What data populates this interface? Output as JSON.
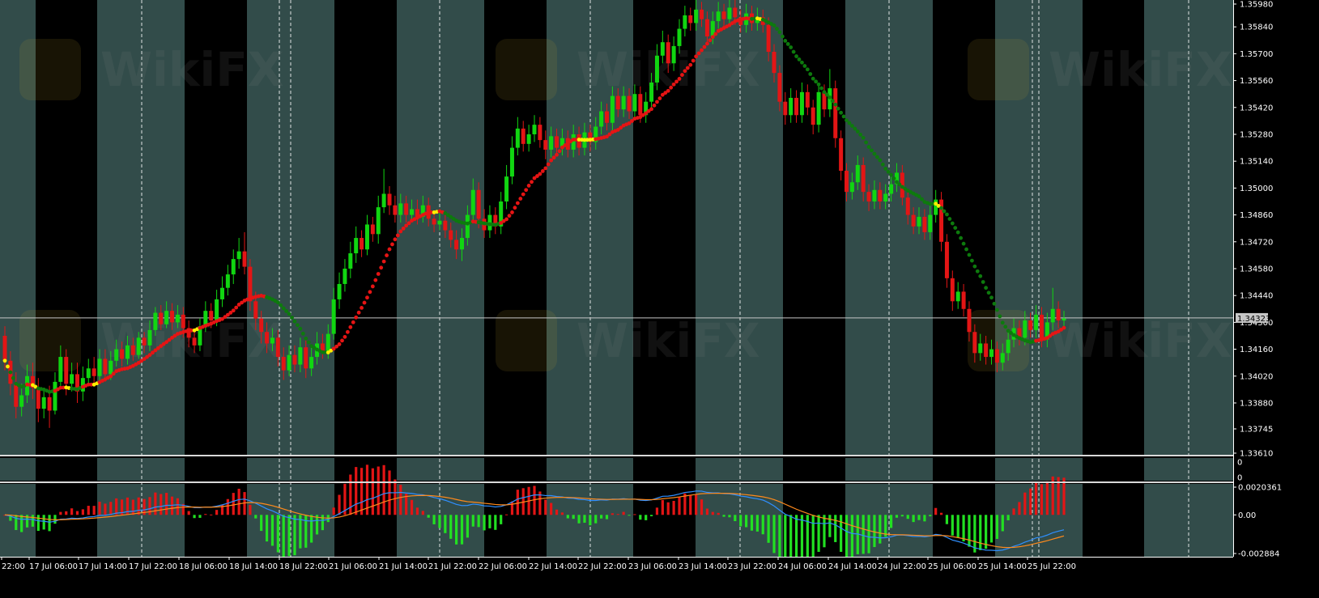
{
  "chart_data": {
    "type": "candlestick",
    "symbol": "",
    "title": "",
    "current_price_label": "1.34323",
    "current_price": 1.34323,
    "colors": {
      "bull": "#11d611",
      "bear": "#e31515",
      "ma_flat": "#ffee00",
      "ma_up": "#e61414",
      "ma_down": "#0d7a0d",
      "session_band": "#324c4a",
      "night_band": "#000000",
      "macd_hist_pos": "#e31515",
      "macd_hist_neg": "#22e022",
      "macd_line": "#2f8fff",
      "signal_line": "#ff8a1c",
      "price_line": "#c6c6c6"
    },
    "price_axis": {
      "ylim": [
        1.3361,
        1.3598
      ],
      "ticks": [
        "1.35980",
        "1.35840",
        "1.35700",
        "1.35560",
        "1.35420",
        "1.35280",
        "1.35140",
        "1.35000",
        "1.34860",
        "1.34720",
        "1.34580",
        "1.34440",
        "1.34300",
        "1.34160",
        "1.34020",
        "1.33880",
        "1.33745",
        "1.33610"
      ]
    },
    "x_axis": {
      "labels": [
        "22:00",
        "17 Jul 06:00",
        "17 Jul 14:00",
        "17 Jul 22:00",
        "18 Jul 06:00",
        "18 Jul 14:00",
        "18 Jul 22:00",
        "21 Jul 06:00",
        "21 Jul 14:00",
        "21 Jul 22:00",
        "22 Jul 06:00",
        "22 Jul 14:00",
        "22 Jul 22:00",
        "23 Jul 06:00",
        "23 Jul 14:00",
        "23 Jul 22:00",
        "24 Jul 06:00",
        "24 Jul 14:00",
        "24 Jul 22:00",
        "25 Jul 06:00",
        "25 Jul 14:00",
        "25 Jul 22:00"
      ]
    },
    "sessions": [
      "night",
      "day",
      "night",
      "day",
      "night",
      "day",
      "night",
      "day",
      "night",
      "day",
      "night",
      "day",
      "night",
      "day",
      "night",
      "day",
      "night",
      "day",
      "night"
    ],
    "candles": [
      [
        1.3423,
        1.341,
        1.3428,
        1.3405
      ],
      [
        1.341,
        1.3398,
        1.3415,
        1.3392
      ],
      [
        1.3398,
        1.3386,
        1.3404,
        1.338
      ],
      [
        1.3386,
        1.3392,
        1.3398,
        1.3381
      ],
      [
        1.3392,
        1.3402,
        1.3408,
        1.3388
      ],
      [
        1.3402,
        1.3396,
        1.3409,
        1.339
      ],
      [
        1.3396,
        1.3385,
        1.3401,
        1.3378
      ],
      [
        1.3385,
        1.3391,
        1.3396,
        1.338
      ],
      [
        1.3391,
        1.3384,
        1.3397,
        1.3375
      ],
      [
        1.3384,
        1.3399,
        1.3404,
        1.3382
      ],
      [
        1.3399,
        1.3412,
        1.3418,
        1.3395
      ],
      [
        1.3412,
        1.3398,
        1.3416,
        1.3392
      ],
      [
        1.3398,
        1.3403,
        1.3409,
        1.3394
      ],
      [
        1.3403,
        1.3394,
        1.3409,
        1.3388
      ],
      [
        1.3394,
        1.3401,
        1.3407,
        1.3389
      ],
      [
        1.3401,
        1.3406,
        1.3411,
        1.3397
      ],
      [
        1.3406,
        1.3402,
        1.3412,
        1.3398
      ],
      [
        1.3402,
        1.3411,
        1.3416,
        1.3399
      ],
      [
        1.3411,
        1.3403,
        1.3416,
        1.3399
      ],
      [
        1.3403,
        1.341,
        1.3415,
        1.34
      ],
      [
        1.341,
        1.3416,
        1.3421,
        1.3407
      ],
      [
        1.3416,
        1.3411,
        1.342,
        1.3407
      ],
      [
        1.3411,
        1.3418,
        1.3423,
        1.3408
      ],
      [
        1.3418,
        1.3413,
        1.3422,
        1.341
      ],
      [
        1.3413,
        1.3422,
        1.3425,
        1.3411
      ],
      [
        1.3422,
        1.3418,
        1.3425,
        1.3414
      ],
      [
        1.3418,
        1.3426,
        1.3431,
        1.3415
      ],
      [
        1.3426,
        1.3435,
        1.3438,
        1.3423
      ],
      [
        1.3435,
        1.3429,
        1.3439,
        1.3426
      ],
      [
        1.3429,
        1.3436,
        1.3441,
        1.3427
      ],
      [
        1.3436,
        1.343,
        1.344,
        1.3426
      ],
      [
        1.343,
        1.3434,
        1.3439,
        1.3427
      ],
      [
        1.3434,
        1.3427,
        1.3438,
        1.3422
      ],
      [
        1.3427,
        1.3422,
        1.3431,
        1.3417
      ],
      [
        1.3422,
        1.3418,
        1.3426,
        1.3414
      ],
      [
        1.3418,
        1.3428,
        1.3432,
        1.3415
      ],
      [
        1.3428,
        1.3436,
        1.3441,
        1.3425
      ],
      [
        1.3436,
        1.3431,
        1.344,
        1.3427
      ],
      [
        1.3431,
        1.3442,
        1.3447,
        1.3428
      ],
      [
        1.3442,
        1.3448,
        1.3454,
        1.3438
      ],
      [
        1.3448,
        1.3455,
        1.346,
        1.3444
      ],
      [
        1.3455,
        1.3463,
        1.3468,
        1.345
      ],
      [
        1.3463,
        1.3467,
        1.3474,
        1.3458
      ],
      [
        1.3467,
        1.3459,
        1.3477,
        1.3455
      ],
      [
        1.3459,
        1.3441,
        1.3463,
        1.3436
      ],
      [
        1.3441,
        1.3432,
        1.3446,
        1.3426
      ],
      [
        1.3432,
        1.3425,
        1.3436,
        1.3419
      ],
      [
        1.3425,
        1.3419,
        1.343,
        1.3414
      ],
      [
        1.3419,
        1.3422,
        1.3427,
        1.3415
      ],
      [
        1.3422,
        1.3412,
        1.3426,
        1.3407
      ],
      [
        1.3412,
        1.3405,
        1.3417,
        1.34
      ],
      [
        1.3405,
        1.3413,
        1.3418,
        1.3402
      ],
      [
        1.3413,
        1.3408,
        1.3418,
        1.3404
      ],
      [
        1.3408,
        1.3417,
        1.3422,
        1.3404
      ],
      [
        1.3417,
        1.3406,
        1.3421,
        1.3401
      ],
      [
        1.3406,
        1.3412,
        1.3418,
        1.3402
      ],
      [
        1.3412,
        1.3419,
        1.3425,
        1.3408
      ],
      [
        1.3419,
        1.3415,
        1.3424,
        1.3411
      ],
      [
        1.3415,
        1.3424,
        1.3429,
        1.3411
      ],
      [
        1.3424,
        1.3442,
        1.3448,
        1.3421
      ],
      [
        1.3442,
        1.345,
        1.3456,
        1.3437
      ],
      [
        1.345,
        1.3458,
        1.3463,
        1.3446
      ],
      [
        1.3458,
        1.3466,
        1.3472,
        1.3453
      ],
      [
        1.3466,
        1.3474,
        1.348,
        1.3461
      ],
      [
        1.3474,
        1.3468,
        1.3478,
        1.3464
      ],
      [
        1.3468,
        1.3481,
        1.3486,
        1.3465
      ],
      [
        1.3481,
        1.3476,
        1.3485,
        1.3472
      ],
      [
        1.3476,
        1.349,
        1.3496,
        1.3471
      ],
      [
        1.349,
        1.3497,
        1.351,
        1.3487
      ],
      [
        1.3497,
        1.3491,
        1.3501,
        1.3486
      ],
      [
        1.3491,
        1.3486,
        1.3496,
        1.3482
      ],
      [
        1.3486,
        1.3492,
        1.3497,
        1.3482
      ],
      [
        1.3492,
        1.3486,
        1.3496,
        1.3482
      ],
      [
        1.3486,
        1.3489,
        1.3494,
        1.3483
      ],
      [
        1.3489,
        1.3485,
        1.3494,
        1.3481
      ],
      [
        1.3485,
        1.3491,
        1.3496,
        1.3482
      ],
      [
        1.3491,
        1.3484,
        1.3495,
        1.348
      ],
      [
        1.3484,
        1.3481,
        1.3488,
        1.3477
      ],
      [
        1.3481,
        1.3483,
        1.3488,
        1.3478
      ],
      [
        1.3483,
        1.3478,
        1.3487,
        1.3474
      ],
      [
        1.3478,
        1.3473,
        1.3482,
        1.3469
      ],
      [
        1.3473,
        1.3468,
        1.3478,
        1.3463
      ],
      [
        1.3468,
        1.3474,
        1.3479,
        1.3462
      ],
      [
        1.3474,
        1.3486,
        1.3491,
        1.347
      ],
      [
        1.3486,
        1.3499,
        1.3505,
        1.3482
      ],
      [
        1.3499,
        1.3484,
        1.3503,
        1.3479
      ],
      [
        1.3484,
        1.3478,
        1.3489,
        1.3474
      ],
      [
        1.3478,
        1.3486,
        1.3491,
        1.3474
      ],
      [
        1.3486,
        1.348,
        1.349,
        1.3476
      ],
      [
        1.348,
        1.3493,
        1.3498,
        1.3476
      ],
      [
        1.3493,
        1.3506,
        1.3512,
        1.3489
      ],
      [
        1.3506,
        1.3521,
        1.3527,
        1.3502
      ],
      [
        1.3521,
        1.3531,
        1.3537,
        1.3517
      ],
      [
        1.3531,
        1.3523,
        1.3535,
        1.3519
      ],
      [
        1.3523,
        1.3528,
        1.3533,
        1.3519
      ],
      [
        1.3528,
        1.3533,
        1.3538,
        1.3524
      ],
      [
        1.3533,
        1.3525,
        1.3537,
        1.3521
      ],
      [
        1.3525,
        1.352,
        1.353,
        1.3515
      ],
      [
        1.352,
        1.3527,
        1.3532,
        1.3516
      ],
      [
        1.3527,
        1.3521,
        1.3531,
        1.3517
      ],
      [
        1.3521,
        1.3526,
        1.3531,
        1.3517
      ],
      [
        1.3526,
        1.352,
        1.353,
        1.3516
      ],
      [
        1.352,
        1.3528,
        1.3533,
        1.3516
      ],
      [
        1.3528,
        1.3521,
        1.3532,
        1.3517
      ],
      [
        1.3521,
        1.3529,
        1.3534,
        1.3517
      ],
      [
        1.3529,
        1.3524,
        1.3533,
        1.3519
      ],
      [
        1.3524,
        1.3532,
        1.3537,
        1.352
      ],
      [
        1.3532,
        1.354,
        1.3545,
        1.3528
      ],
      [
        1.354,
        1.3534,
        1.3544,
        1.353
      ],
      [
        1.3534,
        1.3548,
        1.3553,
        1.353
      ],
      [
        1.3548,
        1.3541,
        1.3552,
        1.3537
      ],
      [
        1.3541,
        1.3548,
        1.3553,
        1.3537
      ],
      [
        1.3548,
        1.354,
        1.3552,
        1.3536
      ],
      [
        1.354,
        1.3549,
        1.3554,
        1.3536
      ],
      [
        1.3549,
        1.3538,
        1.3553,
        1.3534
      ],
      [
        1.3538,
        1.3545,
        1.355,
        1.3534
      ],
      [
        1.3545,
        1.3555,
        1.356,
        1.3541
      ],
      [
        1.3555,
        1.3569,
        1.3575,
        1.3551
      ],
      [
        1.3569,
        1.3576,
        1.3582,
        1.3565
      ],
      [
        1.3576,
        1.3565,
        1.358,
        1.356
      ],
      [
        1.3565,
        1.3574,
        1.3579,
        1.3561
      ],
      [
        1.3574,
        1.3583,
        1.3588,
        1.357
      ],
      [
        1.3583,
        1.359,
        1.3595,
        1.3579
      ],
      [
        1.359,
        1.3586,
        1.3594,
        1.3582
      ],
      [
        1.3586,
        1.3593,
        1.3598,
        1.3582
      ],
      [
        1.3593,
        1.3588,
        1.3597,
        1.3584
      ],
      [
        1.3588,
        1.3579,
        1.3592,
        1.3575
      ],
      [
        1.3579,
        1.3587,
        1.3592,
        1.3575
      ],
      [
        1.3587,
        1.3592,
        1.3597,
        1.3583
      ],
      [
        1.3592,
        1.3588,
        1.3596,
        1.3584
      ],
      [
        1.3588,
        1.3594,
        1.3599,
        1.3584
      ],
      [
        1.3594,
        1.3589,
        1.3598,
        1.3585
      ],
      [
        1.3589,
        1.3585,
        1.3593,
        1.3581
      ],
      [
        1.3585,
        1.3591,
        1.3596,
        1.3581
      ],
      [
        1.3591,
        1.3586,
        1.3595,
        1.3582
      ],
      [
        1.3586,
        1.3589,
        1.3594,
        1.3582
      ],
      [
        1.3589,
        1.3585,
        1.3593,
        1.3581
      ],
      [
        1.3585,
        1.3571,
        1.3589,
        1.3566
      ],
      [
        1.3571,
        1.356,
        1.3575,
        1.3555
      ],
      [
        1.356,
        1.3545,
        1.3564,
        1.354
      ],
      [
        1.3545,
        1.3538,
        1.355,
        1.3533
      ],
      [
        1.3538,
        1.3547,
        1.3552,
        1.3534
      ],
      [
        1.3547,
        1.3538,
        1.3551,
        1.3534
      ],
      [
        1.3538,
        1.355,
        1.3555,
        1.3534
      ],
      [
        1.355,
        1.3542,
        1.3554,
        1.3538
      ],
      [
        1.3542,
        1.3533,
        1.3546,
        1.3528
      ],
      [
        1.3533,
        1.355,
        1.3555,
        1.3529
      ],
      [
        1.355,
        1.3541,
        1.3554,
        1.3537
      ],
      [
        1.3541,
        1.3552,
        1.3562,
        1.3537
      ],
      [
        1.3552,
        1.3526,
        1.3556,
        1.3521
      ],
      [
        1.3526,
        1.3509,
        1.353,
        1.3504
      ],
      [
        1.3509,
        1.3498,
        1.3513,
        1.3493
      ],
      [
        1.3498,
        1.3503,
        1.3508,
        1.3494
      ],
      [
        1.3503,
        1.3512,
        1.3517,
        1.3499
      ],
      [
        1.3512,
        1.3498,
        1.3516,
        1.3493
      ],
      [
        1.3498,
        1.3493,
        1.3502,
        1.3488
      ],
      [
        1.3493,
        1.3499,
        1.3504,
        1.3489
      ],
      [
        1.3499,
        1.3493,
        1.3503,
        1.3489
      ],
      [
        1.3493,
        1.3497,
        1.3502,
        1.3489
      ],
      [
        1.3497,
        1.3502,
        1.3507,
        1.3493
      ],
      [
        1.3502,
        1.3508,
        1.3513,
        1.3498
      ],
      [
        1.3508,
        1.3495,
        1.3512,
        1.3491
      ],
      [
        1.3495,
        1.3486,
        1.3499,
        1.3481
      ],
      [
        1.3486,
        1.348,
        1.349,
        1.3476
      ],
      [
        1.348,
        1.3485,
        1.349,
        1.3476
      ],
      [
        1.3485,
        1.3477,
        1.3489,
        1.3473
      ],
      [
        1.3477,
        1.3486,
        1.3491,
        1.3473
      ],
      [
        1.3486,
        1.3494,
        1.3499,
        1.3482
      ],
      [
        1.3494,
        1.3472,
        1.3498,
        1.3467
      ],
      [
        1.3472,
        1.3453,
        1.3476,
        1.3448
      ],
      [
        1.3453,
        1.3441,
        1.3457,
        1.3436
      ],
      [
        1.3441,
        1.3446,
        1.3451,
        1.3437
      ],
      [
        1.3446,
        1.3437,
        1.345,
        1.3433
      ],
      [
        1.3437,
        1.3425,
        1.3441,
        1.342
      ],
      [
        1.3425,
        1.3414,
        1.3429,
        1.3409
      ],
      [
        1.3414,
        1.3419,
        1.3424,
        1.341
      ],
      [
        1.3419,
        1.3412,
        1.3423,
        1.3408
      ],
      [
        1.3412,
        1.3416,
        1.3421,
        1.3408
      ],
      [
        1.3416,
        1.3409,
        1.342,
        1.3404
      ],
      [
        1.3409,
        1.3414,
        1.3419,
        1.3405
      ],
      [
        1.3414,
        1.3421,
        1.3426,
        1.341
      ],
      [
        1.3421,
        1.3427,
        1.3432,
        1.3417
      ],
      [
        1.3427,
        1.3422,
        1.3431,
        1.3418
      ],
      [
        1.3422,
        1.3431,
        1.3436,
        1.3418
      ],
      [
        1.3431,
        1.3426,
        1.3435,
        1.3422
      ],
      [
        1.3426,
        1.3434,
        1.3439,
        1.3422
      ],
      [
        1.3434,
        1.3421,
        1.3438,
        1.3417
      ],
      [
        1.3421,
        1.343,
        1.3435,
        1.3417
      ],
      [
        1.343,
        1.3437,
        1.3448,
        1.3426
      ],
      [
        1.3437,
        1.3431,
        1.3441,
        1.3427
      ],
      [
        1.3431,
        1.3432,
        1.3436,
        1.3428
      ]
    ],
    "indicator": {
      "name": "MACD",
      "ylim": [
        -0.002884,
        0.002036
      ],
      "ticks": [
        "0.0020361",
        "0.00",
        "-0.002884"
      ]
    },
    "empty_subwindow_ticks": [
      "0",
      "0"
    ]
  }
}
